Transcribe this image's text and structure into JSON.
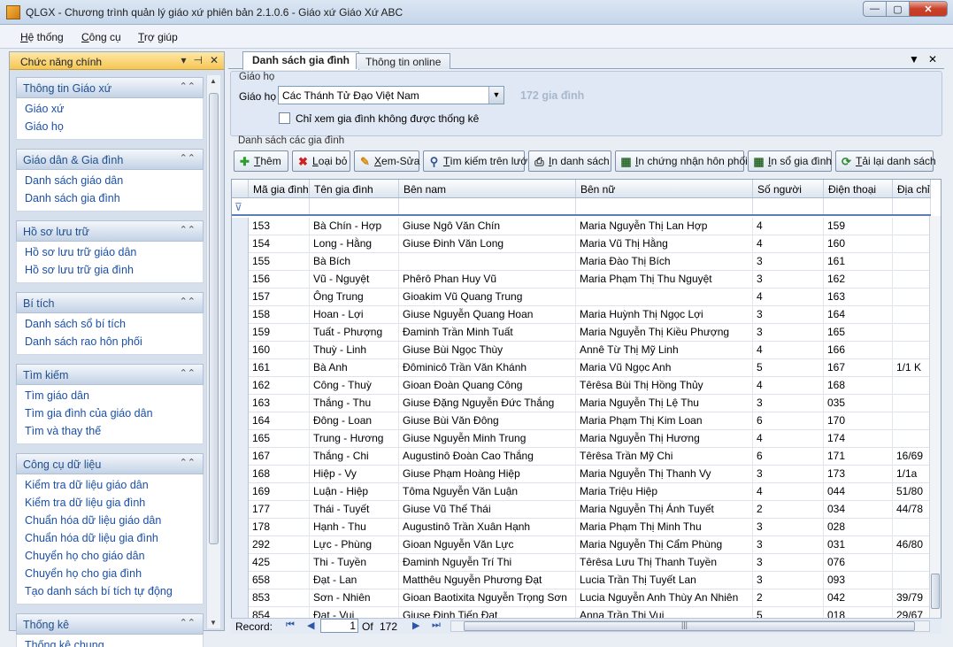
{
  "window": {
    "title": "QLGX - Chương trình quản lý giáo xứ phiên bản 2.1.0.6 - Giáo xứ Giáo Xứ ABC",
    "min": "—",
    "max": "▢",
    "close": "✕"
  },
  "menu": [
    {
      "first": "H",
      "rest": "ệ thống"
    },
    {
      "first": "C",
      "rest": "ông cụ"
    },
    {
      "first": "T",
      "rest": "rợ giúp"
    }
  ],
  "left_panel": {
    "title": "Chức năng chính",
    "icons": {
      "dropdown": "▾",
      "pin": "⊣",
      "close": "✕"
    },
    "collapse_glyph": "⌃⌃",
    "groups": [
      {
        "title": "Thông tin Giáo xứ",
        "items": [
          "Giáo xứ",
          "Giáo họ"
        ]
      },
      {
        "title": "Giáo dân & Gia đình",
        "items": [
          "Danh sách giáo dân",
          "Danh sách gia đình"
        ]
      },
      {
        "title": "Hồ sơ lưu trữ",
        "items": [
          "Hồ sơ lưu trữ giáo dân",
          "Hồ sơ lưu trữ gia đình"
        ]
      },
      {
        "title": "Bí tích",
        "items": [
          "Danh sách sổ bí tích",
          "Danh sách rao hôn phối"
        ]
      },
      {
        "title": "Tìm kiếm",
        "items": [
          "Tìm giáo dân",
          "Tìm gia đình của giáo dân",
          "Tìm và thay thế"
        ]
      },
      {
        "title": "Công cụ dữ liệu",
        "items": [
          "Kiểm tra dữ liệu giáo dân",
          "Kiểm tra dữ liệu gia đình",
          "Chuẩn hóa dữ liệu giáo dân",
          "Chuẩn hóa dữ liệu gia đình",
          "Chuyển họ cho giáo dân",
          "Chuyển họ cho gia đình",
          "Tạo danh sách bí tích tự động"
        ]
      },
      {
        "title": "Thống kê",
        "items": [
          "Thống kê chung"
        ]
      }
    ]
  },
  "tabs": [
    {
      "label": "Danh sách gia đình",
      "active": true
    },
    {
      "label": "Thông tin online",
      "active": false
    }
  ],
  "tab_controls": {
    "menu": "▼",
    "close": "✕"
  },
  "giaoho": {
    "legend": "Giáo họ",
    "label": "Giáo họ",
    "selected": "Các Thánh Tử Đạo Việt Nam",
    "dropdown_glyph": "▼",
    "count": "172 gia đình",
    "checkbox_label": "Chỉ xem gia đình không được thống kê"
  },
  "list": {
    "legend": "Danh sách các gia đình",
    "buttons": [
      {
        "name": "add",
        "icon": "✚",
        "icon_color": "#2e9d2e",
        "u": "T",
        "rest": "hêm"
      },
      {
        "name": "delete",
        "icon": "✖",
        "icon_color": "#d02020",
        "u": "L",
        "rest": "oại bỏ"
      },
      {
        "name": "edit",
        "icon": "✎",
        "icon_color": "#d48a12",
        "u": "X",
        "rest": "em-Sửa"
      },
      {
        "name": "search",
        "icon": "⚲",
        "icon_color": "#2d4f8a",
        "u": "T",
        "rest": "ìm kiếm trên lưới"
      },
      {
        "name": "print-list",
        "icon": "⎙",
        "icon_color": "#333333",
        "u": "I",
        "rest": "n danh sách"
      },
      {
        "name": "print-marriage",
        "icon": "▦",
        "icon_color": "#2d6a2d",
        "u": "I",
        "rest": "n chứng nhận hôn phối"
      },
      {
        "name": "print-family",
        "icon": "▦",
        "icon_color": "#2d6a2d",
        "u": "I",
        "rest": "n sổ gia đình"
      },
      {
        "name": "reload",
        "icon": "⟳",
        "icon_color": "#2d8a2d",
        "u": "T",
        "rest": "ải lại danh sách"
      }
    ],
    "filter_glyph": "⊽",
    "columns": [
      "Mã gia đình",
      "Tên gia đình",
      "Bên nam",
      "Bên nữ",
      "Số người",
      "Điện thoại",
      "Địa chỉ"
    ],
    "rows": [
      [
        "153",
        "Bà Chín - Hợp",
        "Giuse Ngô Văn Chín",
        "Maria Nguyễn Thị Lan Hợp",
        "4",
        "159",
        ""
      ],
      [
        "154",
        "Long - Hằng",
        "Giuse Đinh Văn Long",
        "Maria Vũ Thị Hằng",
        "4",
        "160",
        ""
      ],
      [
        "155",
        "Bà Bích",
        "",
        "Maria Đào Thị Bích",
        "3",
        "161",
        ""
      ],
      [
        "156",
        "Vũ - Nguyệt",
        "Phêrô Phan Huy Vũ",
        "Maria Phạm Thị Thu Nguyệt",
        "3",
        "162",
        ""
      ],
      [
        "157",
        "Ông Trung",
        "Gioakim Vũ Quang Trung",
        "",
        "4",
        "163",
        ""
      ],
      [
        "158",
        "Hoan - Lợi",
        "Giuse Nguyễn Quang Hoan",
        "Maria Huỳnh Thị Ngọc Lợi",
        "3",
        "164",
        ""
      ],
      [
        "159",
        "Tuất - Phượng",
        "Đaminh Trần Minh Tuất",
        "Maria Nguyễn Thị Kiều Phượng",
        "3",
        "165",
        ""
      ],
      [
        "160",
        "Thuỳ - Linh",
        "Giuse Bùi Ngọc Thùy",
        "Annê Từ Thị Mỹ Linh",
        "4",
        "166",
        ""
      ],
      [
        "161",
        "Bà Anh",
        "Đôminicô Trần Văn Khánh",
        "Maria Vũ Ngọc Anh",
        "5",
        "167",
        "1/1 K"
      ],
      [
        "162",
        "Công - Thuỳ",
        "Gioan Đoàn Quang Công",
        "Têrêsa Bùi Thị Hồng Thủy",
        "4",
        "168",
        ""
      ],
      [
        "163",
        "Thắng - Thu",
        "Giuse Đặng Nguyễn Đức Thắng",
        "Maria Nguyễn Thị Lệ Thu",
        "3",
        "035",
        ""
      ],
      [
        "164",
        "Đông - Loan",
        "Giuse Bùi Văn Đông",
        "Maria Phạm Thị Kim Loan",
        "6",
        "170",
        ""
      ],
      [
        "165",
        "Trung - Hương",
        "Giuse Nguyễn Minh Trung",
        "Maria Nguyễn Thị Hương",
        "4",
        "174",
        ""
      ],
      [
        "167",
        "Thắng - Chi",
        "Augustinô Đoàn Cao Thắng",
        "Têrêsa Trần Mỹ Chi",
        "6",
        "171",
        "16/69"
      ],
      [
        "168",
        "Hiệp - Vy",
        "Giuse Phạm Hoàng Hiệp",
        "Maria Nguyễn Thị Thanh Vy",
        "3",
        "173",
        "1/1a"
      ],
      [
        "169",
        "Luận - Hiệp",
        "Tôma Nguyễn Văn Luận",
        "Maria Triệu Hiệp",
        "4",
        "044",
        "51/80"
      ],
      [
        "177",
        "Thái - Tuyết",
        "Giuse Vũ Thế Thái",
        "Maria Nguyễn Thị Ánh Tuyết",
        "2",
        "034",
        "44/78"
      ],
      [
        "178",
        "Hạnh - Thu",
        "Augustinô Trần Xuân Hạnh",
        "Maria Phạm Thị Minh Thu",
        "3",
        "028",
        ""
      ],
      [
        "292",
        "Lực - Phùng",
        "Gioan Nguyễn Văn Lực",
        "Maria Nguyễn Thị Cẩm Phùng",
        "3",
        "031",
        "46/80"
      ],
      [
        "425",
        "Thi - Tuyền",
        "Đaminh Nguyễn Trí Thi",
        "Têrêsa Lưu Thị Thanh Tuyền",
        "3",
        "076",
        ""
      ],
      [
        "658",
        "Đạt - Lan",
        "Matthêu Nguyễn Phương Đạt",
        "Lucia Trần Thị Tuyết Lan",
        "3",
        "093",
        ""
      ],
      [
        "853",
        "Sơn - Nhiên",
        "Gioan Baotixita Nguyễn Trọng Sơn",
        "Lucia Nguyễn Anh Thùy An Nhiên",
        "2",
        "042",
        "39/79"
      ],
      [
        "854",
        "Đạt - Vui",
        "Giuse Đinh Tiến Đạt",
        "Anna Trần Thị Vui",
        "5",
        "018",
        "29/67"
      ]
    ]
  },
  "navigator": {
    "label": "Record:",
    "first": "⏮",
    "prev": "◀",
    "next": "▶",
    "last": "⏭",
    "page": "1",
    "of": "Of",
    "total": "172",
    "grip": "|||"
  }
}
